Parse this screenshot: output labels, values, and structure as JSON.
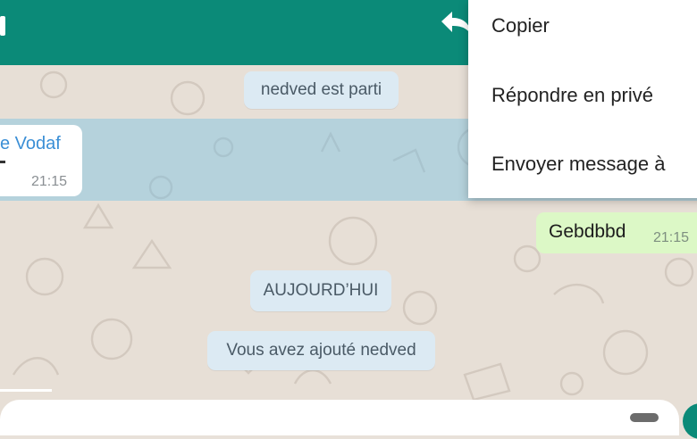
{
  "colors": {
    "header": "#0b8a78",
    "incoming_sender": "#3b8fd6",
    "outgoing_bubble": "#dcf8c6",
    "system_bubble": "#dceaf3",
    "selection_highlight": "#63bee8"
  },
  "header": {
    "icons": [
      "back-arrow-icon",
      "reply-icon"
    ]
  },
  "context_menu": {
    "items": [
      {
        "label": "Copier"
      },
      {
        "label": "Répondre en privé"
      },
      {
        "label": "Envoyer message à"
      }
    ]
  },
  "messages": {
    "system_left": "nedved est parti",
    "incoming": {
      "sender": "e Vodaf",
      "time": "21:15"
    },
    "outgoing": {
      "text": "Gebdbbd",
      "time": "21:15"
    },
    "date_divider": "AUJOURD’HUI",
    "system_added": "Vous avez ajouté nedved"
  }
}
